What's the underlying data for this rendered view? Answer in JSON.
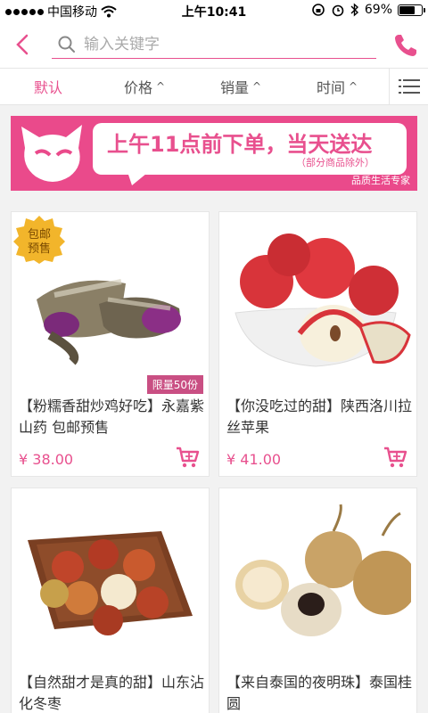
{
  "status_bar": {
    "carrier": "中国移动",
    "time": "上午10:41",
    "battery": "69%",
    "battery_level": 0.69
  },
  "search": {
    "placeholder": "输入关键字"
  },
  "sort_tabs": [
    {
      "label": "默认",
      "active": true
    },
    {
      "label": "价格",
      "active": false
    },
    {
      "label": "销量",
      "active": false
    },
    {
      "label": "时间",
      "active": false
    }
  ],
  "banner": {
    "title": "上午11点前下单，当天送达",
    "subtitle": "（部分商品除外）",
    "brand": "品质生活专家"
  },
  "products": [
    {
      "title": "【粉糯香甜炒鸡好吃】永嘉紫山药 包邮预售",
      "price": "¥ 38.00",
      "badge": "包邮\n预售",
      "badge_line1": "包邮",
      "badge_line2": "预售",
      "limit": "限量50份"
    },
    {
      "title": "【你没吃过的甜】陕西洛川拉丝苹果",
      "price": "¥ 41.00"
    },
    {
      "title": "【自然甜才是真的甜】山东沾化冬枣",
      "price": ""
    },
    {
      "title": "【来自泰国的夜明珠】泰国桂圆",
      "price": ""
    }
  ],
  "colors": {
    "accent": "#e8508e",
    "banner_bg": "#ea4a8b"
  }
}
